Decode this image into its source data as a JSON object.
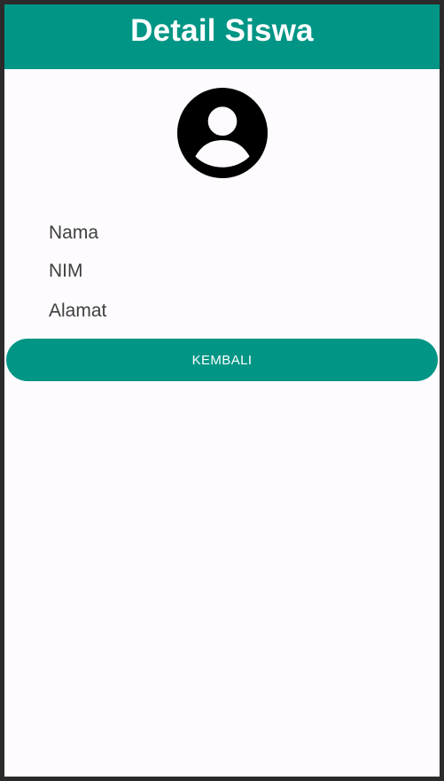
{
  "app_bar": {
    "title": "Detail Siswa",
    "color": "#009585"
  },
  "profile": {
    "avatar_icon": "account-circle-icon",
    "fields": {
      "name_label": "Nama",
      "nim_label": "NIM",
      "address_label": "Alamat"
    }
  },
  "actions": {
    "back_label": "KEMBALI",
    "button_color": "#009585"
  },
  "colors": {
    "background": "#fefbfe",
    "text": "#3f3f3f",
    "button_text": "#ffffff"
  }
}
